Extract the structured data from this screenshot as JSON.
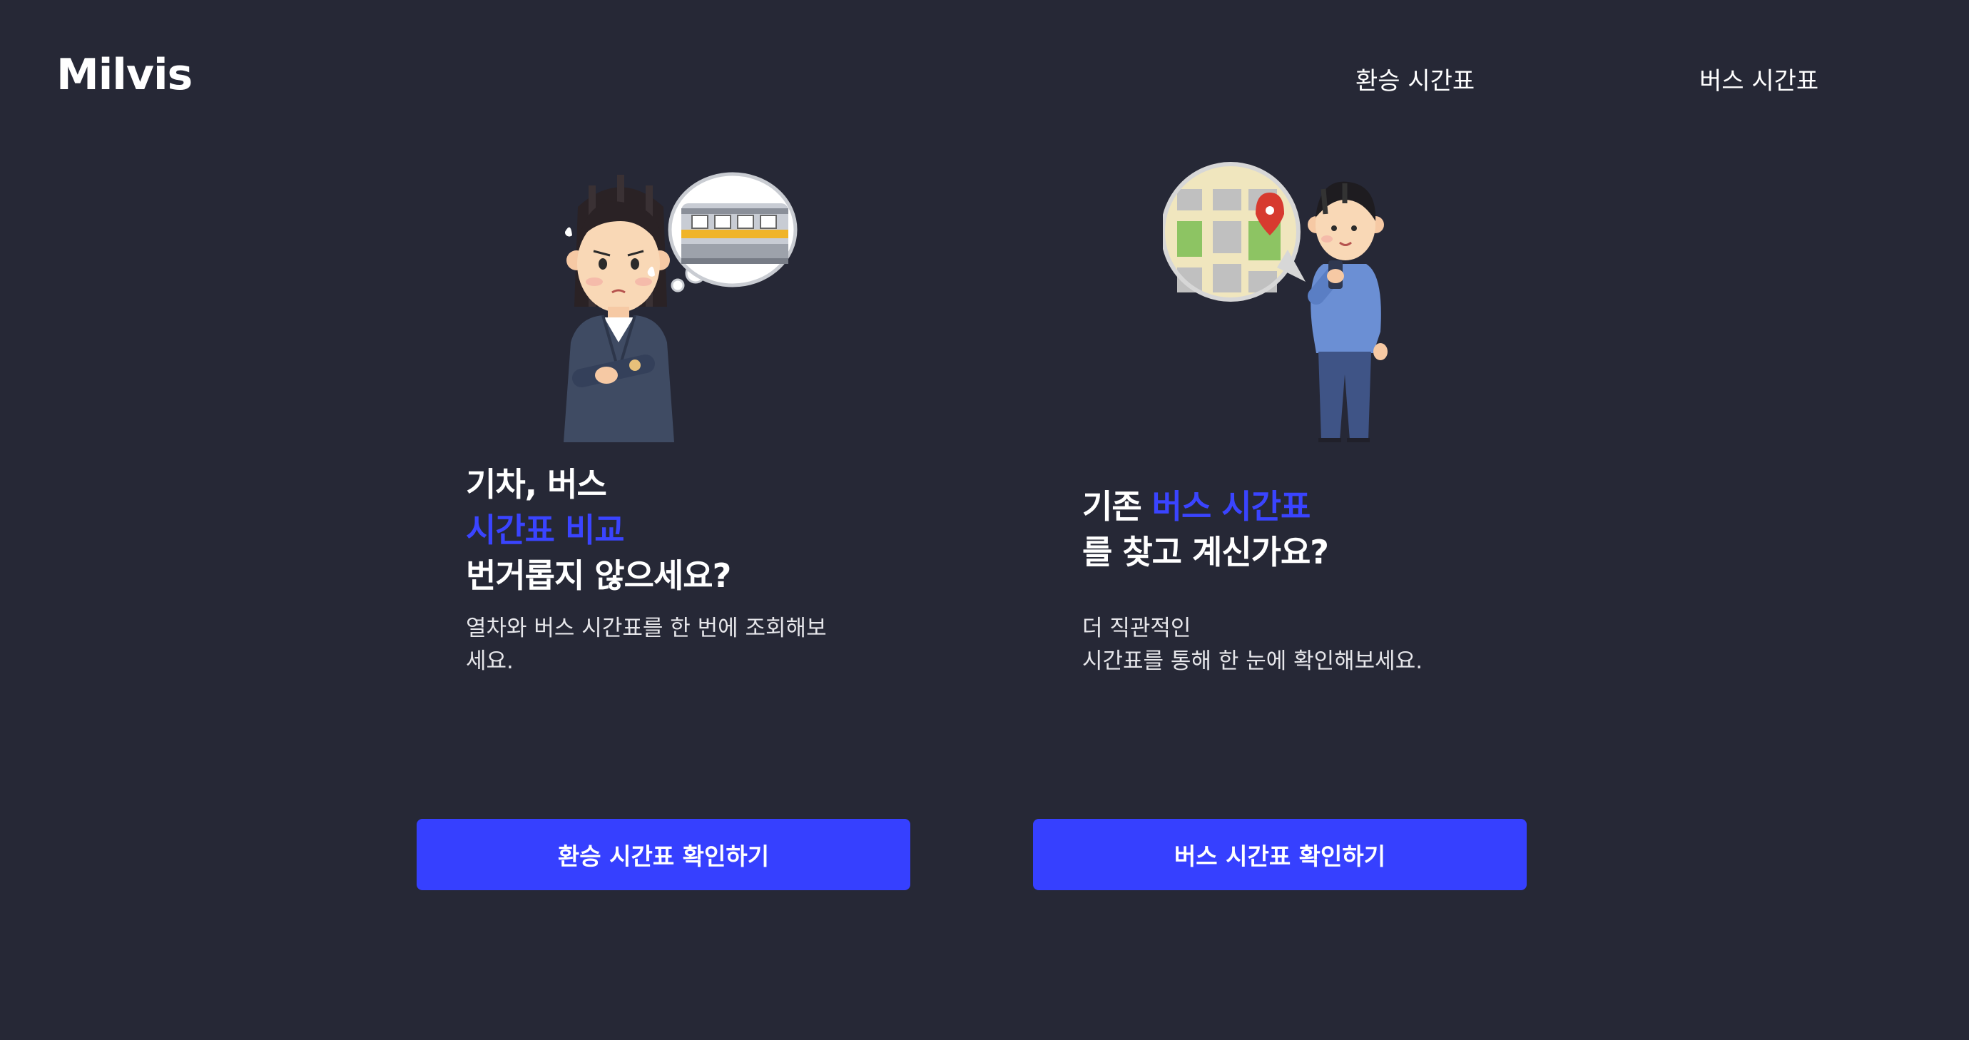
{
  "header": {
    "logo": "Milvis",
    "nav": {
      "transfer": "환승 시간표",
      "bus": "버스 시간표"
    }
  },
  "left_card": {
    "headline_line1": "기차, 버스",
    "headline_line2_accent": "시간표 비교",
    "headline_line3": "번거롭지 않으세요?",
    "desc_line1": "열차와 버스 시간표를 한 번에 조회해보",
    "desc_line2": "세요.",
    "button": "환승 시간표 확인하기"
  },
  "right_card": {
    "headline_prefix": "기존 ",
    "headline_accent": "버스 시간표",
    "headline_line2": "를 찾고 계신가요?",
    "desc_line1": "더 직관적인",
    "desc_line2": "시간표를 통해 한 눈에 확인해보세요.",
    "button": "버스 시간표 확인하기"
  },
  "colors": {
    "background": "#262836",
    "accent": "#3a44ff",
    "button": "#3640ff",
    "text": "#ffffff"
  },
  "illustrations": {
    "left": "worried-woman-thinking-of-train-illustration",
    "right": "man-checking-map-on-phone-illustration"
  }
}
